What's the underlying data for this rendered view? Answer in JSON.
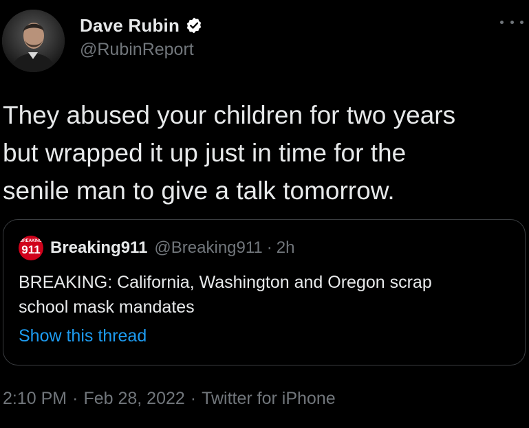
{
  "author": {
    "display_name": "Dave Rubin",
    "handle": "@RubinReport",
    "verified": true,
    "verified_color": "#ffffff",
    "avatar_icon": "profile-photo"
  },
  "more_icon": "more-horizontal-icon",
  "tweet": {
    "text": "They abused your children for two years\nbut wrapped it up just in time for the\nsenile man to give a talk tomorrow."
  },
  "quote": {
    "avatar": {
      "small_text": "BREAKING",
      "big_text": "911",
      "color": "#d0021b"
    },
    "display_name": "Breaking911",
    "handle": "@Breaking911",
    "separator": "·",
    "time": "2h",
    "text": "BREAKING: California, Washington and Oregon scrap\nschool mask mandates",
    "show_thread_label": "Show this thread",
    "link_color": "#1d9bf0"
  },
  "meta": {
    "time": "2:10 PM",
    "separator": "·",
    "date": "Feb 28, 2022",
    "source": "Twitter for iPhone"
  }
}
